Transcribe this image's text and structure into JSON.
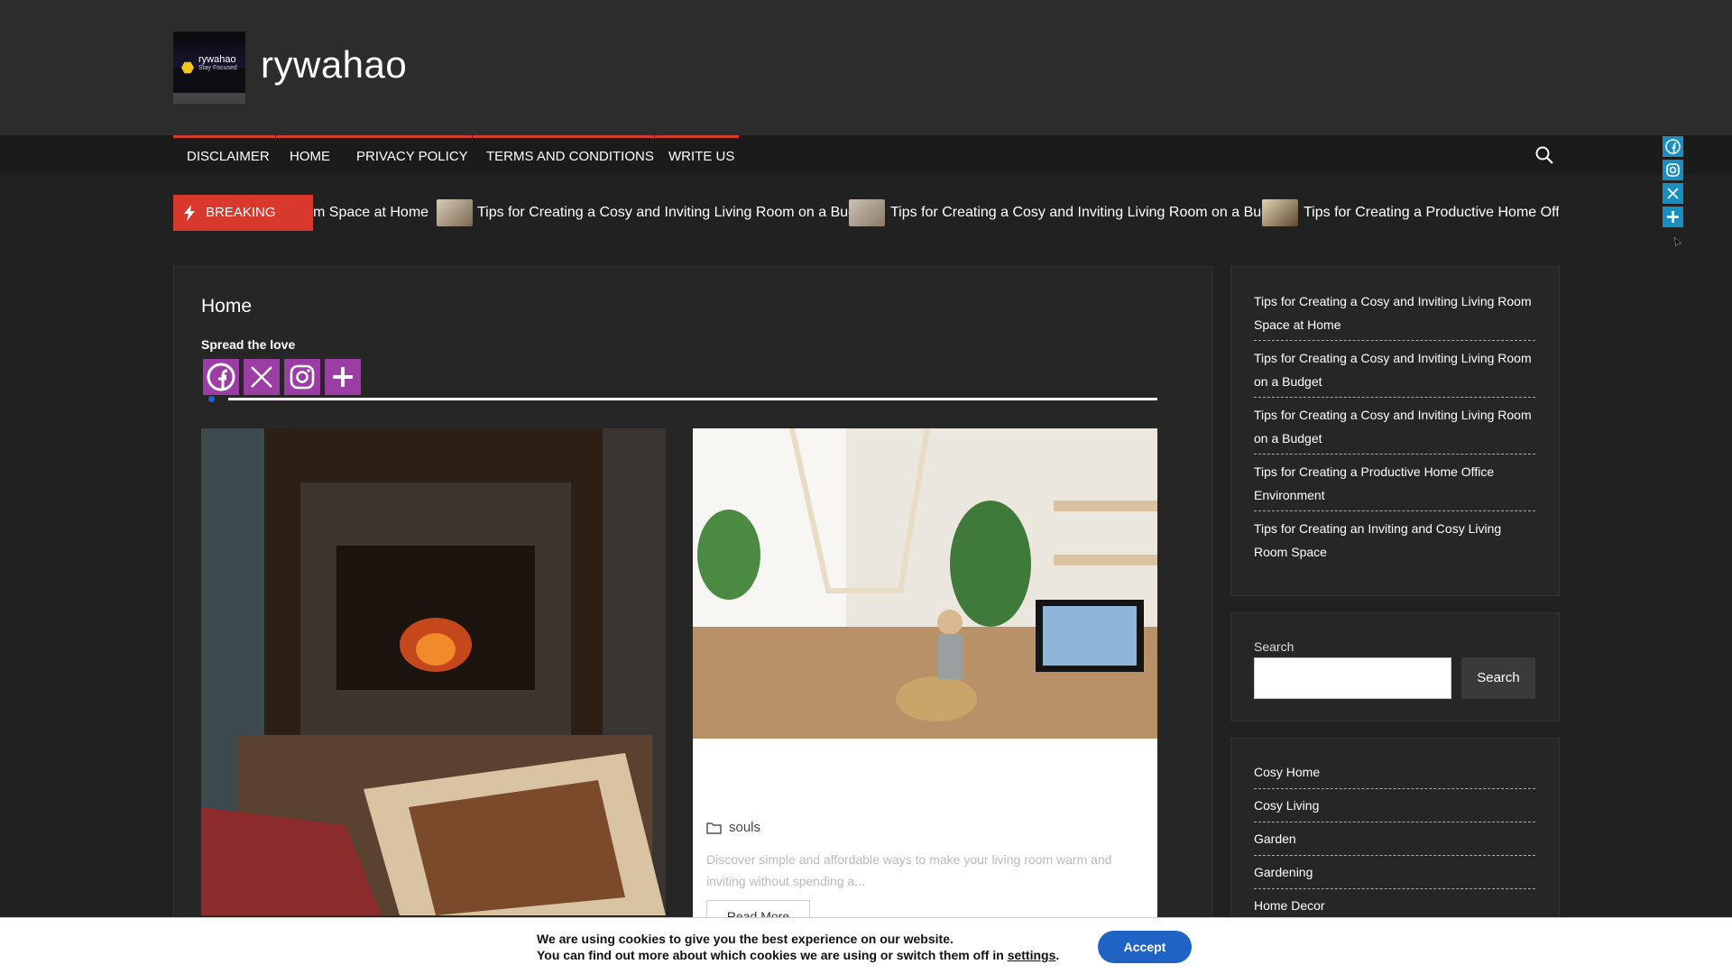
{
  "site": {
    "title": "rywahao",
    "logo_text": "rywahao",
    "logo_tagline": "Stay Focused"
  },
  "nav": {
    "items": [
      "DISCLAIMER",
      "HOME",
      "PRIVACY POLICY",
      "TERMS AND CONDITIONS",
      "WRITE US"
    ]
  },
  "ticker": {
    "label": "BREAKING NEWS",
    "items": [
      "m Space at Home",
      "Tips for Creating a Cosy and Inviting Living Room on a Budget",
      "Tips for Creating a Cosy and Inviting Living Room on a Budget",
      "Tips for Creating a Productive Home Office"
    ]
  },
  "main": {
    "page_title": "Home",
    "spread_label": "Spread the love",
    "post2": {
      "category": "souls",
      "excerpt": "Discover simple and affordable ways to make your living room warm and inviting without spending a...",
      "read_more": "Read More"
    }
  },
  "sidebar": {
    "recent": [
      "Tips for Creating a Cosy and Inviting Living Room Space at Home",
      "Tips for Creating a Cosy and Inviting Living Room on a Budget",
      "Tips for Creating a Cosy and Inviting Living Room on a Budget",
      "Tips for Creating a Productive Home Office Environment",
      "Tips for Creating an Inviting and Cosy Living Room Space"
    ],
    "search_label": "Search",
    "search_button": "Search",
    "categories": [
      "Cosy Home",
      "Cosy Living",
      "Garden",
      "Gardening",
      "Home Decor"
    ]
  },
  "cookie": {
    "line1": "We are using cookies to give you the best experience on our website.",
    "line2_prefix": "You can find out more about which cookies we are using or switch them off in",
    "settings_link": "settings",
    "line2_suffix": ".",
    "accept": "Accept"
  },
  "colors": {
    "accent": "#d9382c",
    "share": "#9c3da5",
    "side_social": "#1a8fbf",
    "accept": "#1f64c4"
  },
  "icons": {
    "share": [
      "facebook-icon",
      "x-icon",
      "instagram-icon",
      "plus-icon"
    ],
    "side_social": [
      "facebook-icon",
      "instagram-icon",
      "x-icon",
      "plus-icon"
    ]
  }
}
